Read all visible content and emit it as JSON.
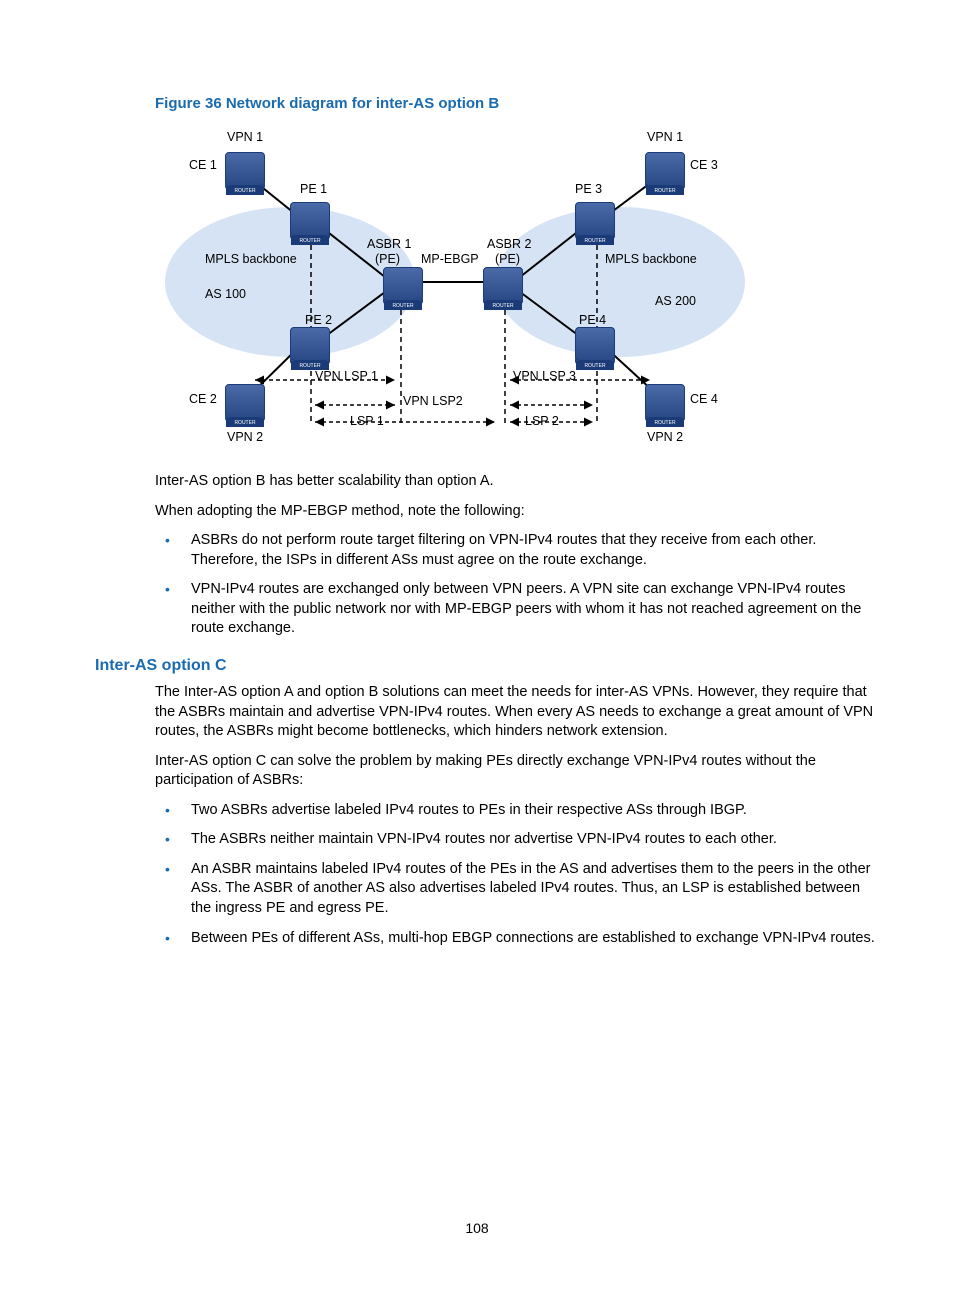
{
  "figure_caption": "Figure 36 Network diagram for inter-AS option B",
  "diagram_labels": {
    "vpn1_left": "VPN 1",
    "vpn1_right": "VPN 1",
    "vpn2_left": "VPN 2",
    "vpn2_right": "VPN 2",
    "ce1": "CE 1",
    "ce2": "CE 2",
    "ce3": "CE 3",
    "ce4": "CE 4",
    "pe1": "PE 1",
    "pe2": "PE 2",
    "pe3": "PE 3",
    "pe4": "PE 4",
    "asbr1": "ASBR 1",
    "asbr1_pe": "(PE)",
    "asbr2": "ASBR 2",
    "asbr2_pe": "(PE)",
    "mp_ebgp": "MP-EBGP",
    "mpls_left": "MPLS backbone",
    "mpls_right": "MPLS backbone",
    "as100": "AS 100",
    "as200": "AS 200",
    "vpn_lsp1": "VPN LSP 1",
    "vpn_lsp2": "VPN LSP2",
    "vpn_lsp3": "VPN LSP 3",
    "lsp1": "LSP 1",
    "lsp2": "LSP 2"
  },
  "paragraphs": {
    "p1": "Inter-AS option B has better scalability than option A.",
    "p2": "When adopting the MP-EBGP method, note the following:",
    "p3": "The Inter-AS option A and option B solutions can meet the needs for inter-AS VPNs. However, they require that the ASBRs maintain and advertise VPN-IPv4 routes. When every AS needs to exchange a great amount of VPN routes, the ASBRs might become bottlenecks, which hinders network extension.",
    "p4": "Inter-AS option C can solve the problem by making PEs directly exchange VPN-IPv4 routes without the participation of ASBRs:"
  },
  "list1": [
    "ASBRs do not perform route target filtering on VPN-IPv4 routes that they receive from each other. Therefore, the ISPs in different ASs must agree on the route exchange.",
    "VPN-IPv4 routes are exchanged only between VPN peers. A VPN site can exchange VPN-IPv4 routes neither with the public network nor with MP-EBGP peers with whom it has not reached agreement on the route exchange."
  ],
  "heading_c": "Inter-AS option C",
  "list2": [
    "Two ASBRs advertise labeled IPv4 routes to PEs in their respective ASs through IBGP.",
    "The ASBRs neither maintain VPN-IPv4 routes nor advertise VPN-IPv4 routes to each other.",
    "An ASBR maintains labeled IPv4 routes of the PEs in the AS and advertises them to the peers in the other ASs. The ASBR of another AS also advertises labeled IPv4 routes. Thus, an LSP is established between the ingress PE and egress PE.",
    "Between PEs of different ASs, multi-hop EBGP connections are established to exchange VPN-IPv4 routes."
  ],
  "page_number": "108"
}
